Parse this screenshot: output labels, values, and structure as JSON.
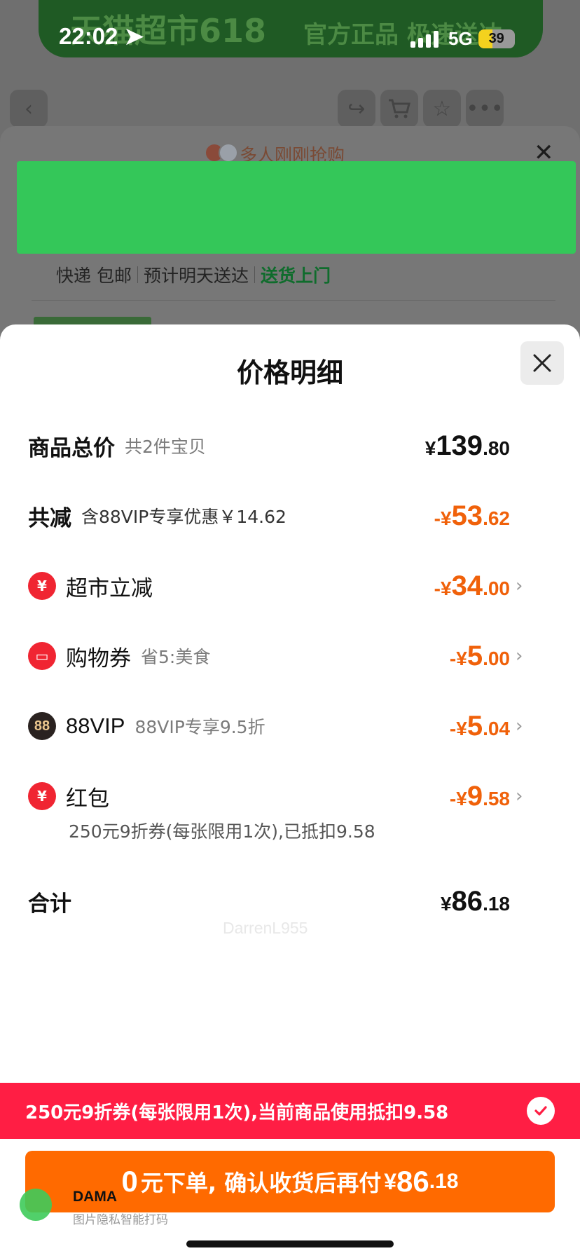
{
  "status_bar": {
    "time": "22:02",
    "network": "5G",
    "battery": "39"
  },
  "background": {
    "banner_left": "天猫超市618",
    "banner_right": "官方正品 极速送达",
    "recent_buyers": "多人刚刚抢购",
    "delivery": {
      "method": "快递 包邮",
      "eta": "预计明天送达",
      "door": "送货上门"
    }
  },
  "modal": {
    "title": "价格明细",
    "rows": {
      "total": {
        "label": "商品总价",
        "sub": "共2件宝贝",
        "currency": "¥",
        "int": "139",
        "dec": ".80"
      },
      "discount": {
        "label": "共减",
        "sub": "含88VIP专享优惠￥14.62",
        "currency": "-¥",
        "int": "53",
        "dec": ".62"
      },
      "market": {
        "label": "超市立减",
        "currency": "-¥",
        "int": "34",
        "dec": ".00"
      },
      "coupon": {
        "label": "购物券",
        "sub": "省5:美食",
        "currency": "-¥",
        "int": "5",
        "dec": ".00"
      },
      "vip": {
        "label": "88VIP",
        "sub": "88VIP专享9.5折",
        "currency": "-¥",
        "int": "5",
        "dec": ".04",
        "icon_text": "88"
      },
      "redpacket": {
        "label": "红包",
        "currency": "-¥",
        "int": "9",
        "dec": ".58",
        "note": "250元9折券(每张限用1次),已抵扣9.58"
      },
      "sum": {
        "label": "合计",
        "currency": "¥",
        "int": "86",
        "dec": ".18"
      }
    },
    "watermark": "DarrenL955"
  },
  "coupon_bar": {
    "text": "250元9折券(每张限用1次),当前商品使用抵扣9.58"
  },
  "pay_button": {
    "zero": "0",
    "text": "元下单, 确认收货后再付",
    "currency": "¥",
    "int": "86",
    "dec": ".18"
  },
  "dama": {
    "brand": "DAMA",
    "slogan": "图片隐私智能打码"
  },
  "colors": {
    "accent_orange": "#f0610a",
    "coupon_red": "#ff1e44",
    "pay_orange": "#ff6a00",
    "redact_green": "#34c759"
  }
}
